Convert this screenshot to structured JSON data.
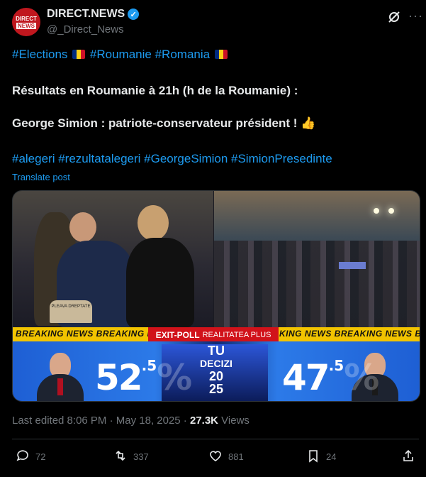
{
  "account": {
    "avatar_line1": "DIRECT",
    "avatar_line2": "NEWS",
    "display_name": "DIRECT.NEWS",
    "handle": "@_Direct_News",
    "verified_icon": "verified-badge-icon"
  },
  "post": {
    "tags_line1": [
      "#Elections",
      "#Roumanie",
      "#Romania"
    ],
    "line2": "Résultats en Roumanie à 21h (h de la Roumanie) :",
    "line3": "George Simion : patriote-conservateur président !",
    "tags_line4": "#alegeri #rezultatalegeri #GeorgeSimion #SimionPresedinte",
    "translate": "Translate post"
  },
  "media": {
    "ticker_left": "BREAKING NEWS  BREAKING NEWS  BREAKING",
    "ticker_right": "KING NEWS  BREAKING NEWS  BREAKIN",
    "exitpoll_label": "EXIT-POLL",
    "exitpoll_channel": "REALITATEA PLUS",
    "logo_line1": "TU",
    "logo_line2": "DECIZI",
    "logo_line3": "20",
    "logo_line4": "25",
    "pct_left_main": "52",
    "pct_left_dec": ".5",
    "pct_left_sym": "%",
    "pct_right_main": "47",
    "pct_right_dec": ".5",
    "pct_right_sym": "%",
    "sign_text": "PLEAVA DREPTATE"
  },
  "meta": {
    "edited": "Last edited 8:06 PM · May 18, 2025 · ",
    "views_count": "27.3K",
    "views_label": " Views"
  },
  "actions": {
    "replies": "72",
    "reposts": "337",
    "likes": "881",
    "bookmarks": "24"
  },
  "colors": {
    "accent": "#1d9bf0",
    "background": "#000000",
    "muted": "#71767b",
    "ticker": "#f2c400",
    "exitpoll": "#d1121a"
  }
}
